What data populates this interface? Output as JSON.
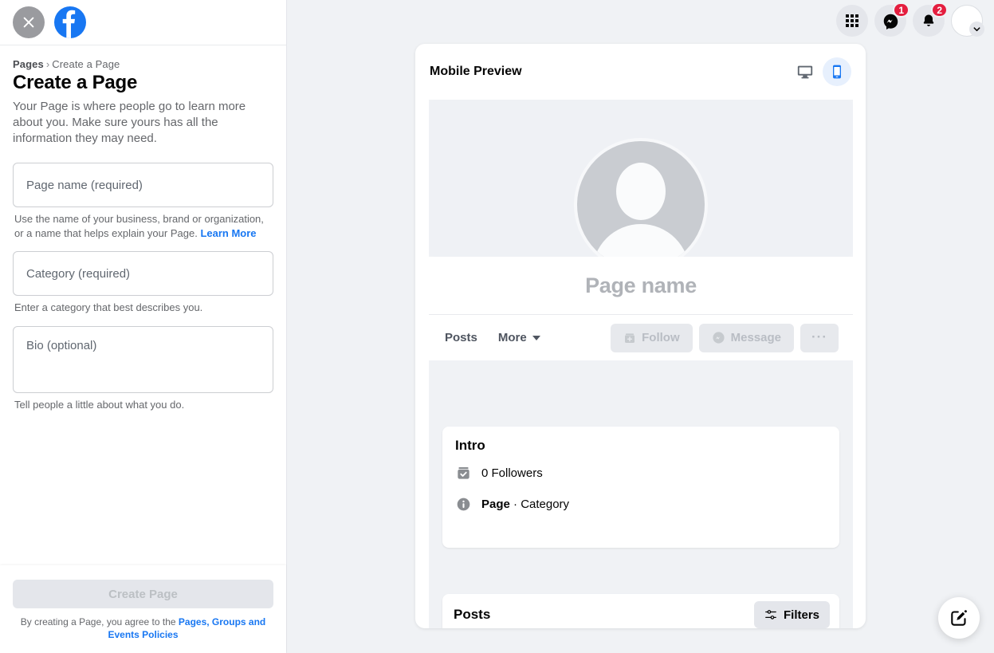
{
  "window": {
    "background_color": "#f0f2f5",
    "brand_color": "#1877f2"
  },
  "sidebar": {
    "close_icon": "close-x-icon",
    "logo_icon": "facebook-logo-icon",
    "breadcrumb": {
      "root": "Pages",
      "separator": "›",
      "current": "Create a Page"
    },
    "title": "Create a Page",
    "description": "Your Page is where people go to learn more about you. Make sure yours has all the information they may need.",
    "fields": [
      {
        "name": "page-name",
        "placeholder": "Page name (required)",
        "value": "",
        "helper": "Use the name of your business, brand or organization, or a name that helps explain your Page.",
        "helper_link": "Learn More"
      },
      {
        "name": "category",
        "placeholder": "Category (required)",
        "value": "",
        "helper": "Enter a category that best describes you.",
        "helper_link": ""
      },
      {
        "name": "bio",
        "placeholder": "Bio (optional)",
        "value": "",
        "helper": "Tell people a little about what you do.",
        "helper_link": ""
      }
    ],
    "submit_label": "Create Page",
    "tos_prefix": "By creating a Page, you agree to the ",
    "tos_link": "Pages, Groups and Events Policies"
  },
  "topnav": {
    "items": [
      {
        "icon": "menu-grid-icon",
        "badge": ""
      },
      {
        "icon": "messenger-icon",
        "badge": "1"
      },
      {
        "icon": "notifications-bell-icon",
        "badge": "2"
      }
    ],
    "account": {
      "icon": "account-avatar-icon",
      "chevron": "chevron-down-icon"
    },
    "badge_color": "#e41e3f"
  },
  "preview": {
    "title": "Mobile Preview",
    "toggles": [
      {
        "name": "desktop",
        "icon": "desktop-monitor-icon",
        "active": false
      },
      {
        "name": "mobile",
        "icon": "mobile-phone-icon",
        "active": true
      }
    ],
    "profile": {
      "avatar_icon": "default-profile-avatar-icon",
      "page_name": "Page name"
    },
    "tabs": [
      {
        "label": "Posts",
        "has_caret": false
      },
      {
        "label": "More",
        "has_caret": true
      }
    ],
    "actions": [
      {
        "label": "Follow",
        "icon": "follow-plus-icon",
        "disabled": true
      },
      {
        "label": "Message",
        "icon": "messenger-icon",
        "disabled": true
      },
      {
        "label": "",
        "icon": "more-options-icon",
        "disabled": true,
        "dots": "···"
      }
    ],
    "intro": {
      "title": "Intro",
      "rows": [
        {
          "icon": "followers-badge-icon",
          "text": "0 Followers",
          "bold_prefix": ""
        },
        {
          "icon": "info-circle-icon",
          "text": " · Category",
          "bold_prefix": "Page"
        }
      ]
    },
    "posts": {
      "title": "Posts",
      "filters_label": "Filters",
      "filters_icon": "filters-sliders-icon"
    }
  },
  "fab": {
    "icon": "compose-edit-icon",
    "name": "compose-button"
  }
}
